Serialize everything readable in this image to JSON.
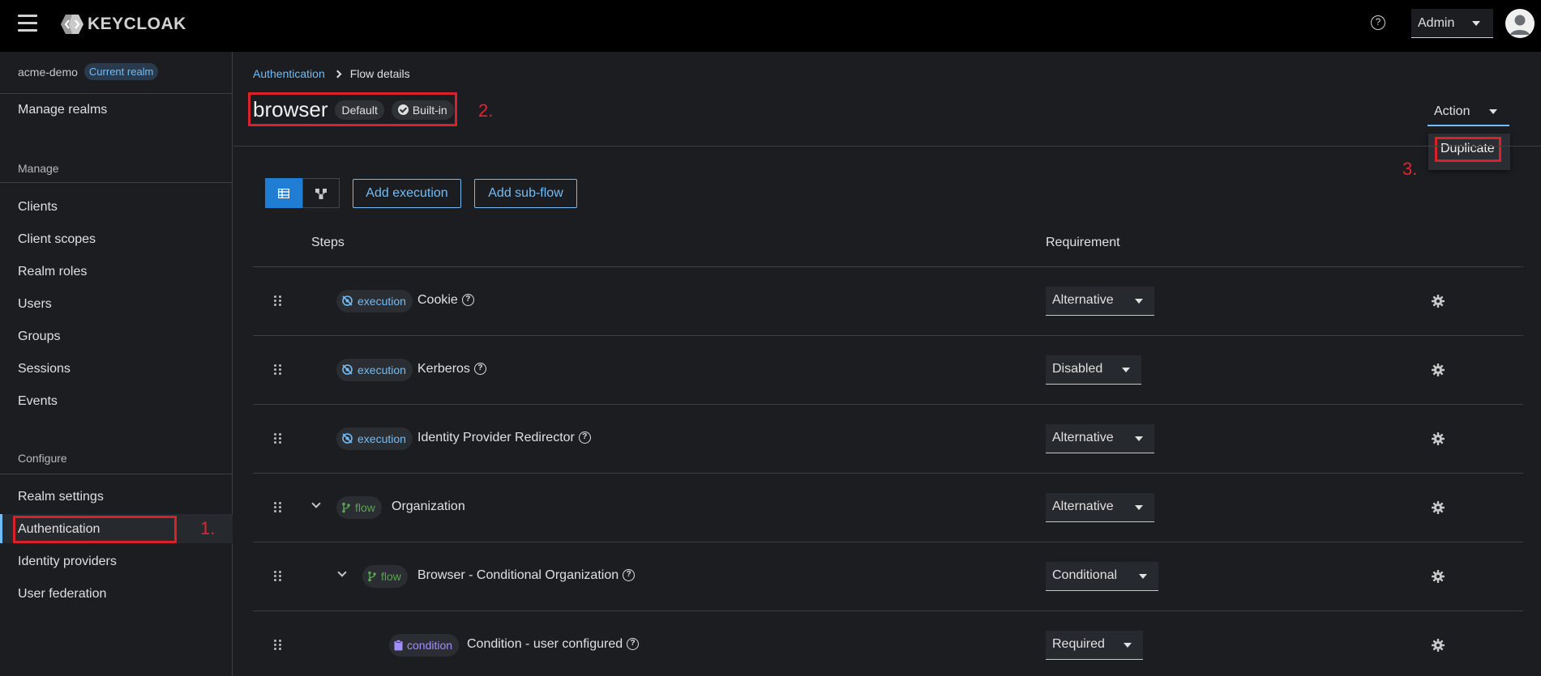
{
  "header": {
    "brand": "KEYCLOAK",
    "user_label": "Admin",
    "help_glyph": "?"
  },
  "sidebar": {
    "realm_name": "acme-demo",
    "realm_badge": "Current realm",
    "manage_realms": "Manage realms",
    "group_manage": "Manage",
    "manage_items": [
      "Clients",
      "Client scopes",
      "Realm roles",
      "Users",
      "Groups",
      "Sessions",
      "Events"
    ],
    "group_configure": "Configure",
    "configure_items": [
      "Realm settings",
      "Authentication",
      "Identity providers",
      "User federation"
    ],
    "active_item": "Authentication"
  },
  "annotations": {
    "step1": "1.",
    "step2": "2.",
    "step3": "3.",
    "color": "#d8212a"
  },
  "breadcrumb": {
    "parent": "Authentication",
    "current": "Flow details"
  },
  "flow": {
    "title": "browser",
    "label_default": "Default",
    "label_builtin": "Built-in"
  },
  "action_menu": {
    "label": "Action",
    "items": [
      "Duplicate"
    ]
  },
  "toolbar": {
    "add_execution": "Add execution",
    "add_subflow": "Add sub-flow",
    "view_table_icon": "table-icon",
    "view_diagram_icon": "diagram-icon"
  },
  "table": {
    "col_steps": "Steps",
    "col_requirement": "Requirement",
    "rows": [
      {
        "type": "execution",
        "name": "Cookie",
        "help": true,
        "requirement": "Alternative",
        "expandable": false,
        "level": 0
      },
      {
        "type": "execution",
        "name": "Kerberos",
        "help": true,
        "requirement": "Disabled",
        "expandable": false,
        "level": 0
      },
      {
        "type": "execution",
        "name": "Identity Provider Redirector",
        "help": true,
        "requirement": "Alternative",
        "expandable": false,
        "level": 0
      },
      {
        "type": "flow",
        "name": "Organization",
        "help": false,
        "requirement": "Alternative",
        "expandable": true,
        "level": 0
      },
      {
        "type": "flow",
        "name": "Browser - Conditional Organization",
        "help": true,
        "requirement": "Conditional",
        "expandable": true,
        "level": 1
      },
      {
        "type": "condition",
        "name": "Condition - user configured",
        "help": true,
        "requirement": "Required",
        "expandable": false,
        "level": 2
      }
    ]
  },
  "colors": {
    "accent": "#73bcf7",
    "primary": "#1f7dd3",
    "flow": "#5ba352",
    "condition": "#a18fff",
    "background": "#1b1d21"
  }
}
